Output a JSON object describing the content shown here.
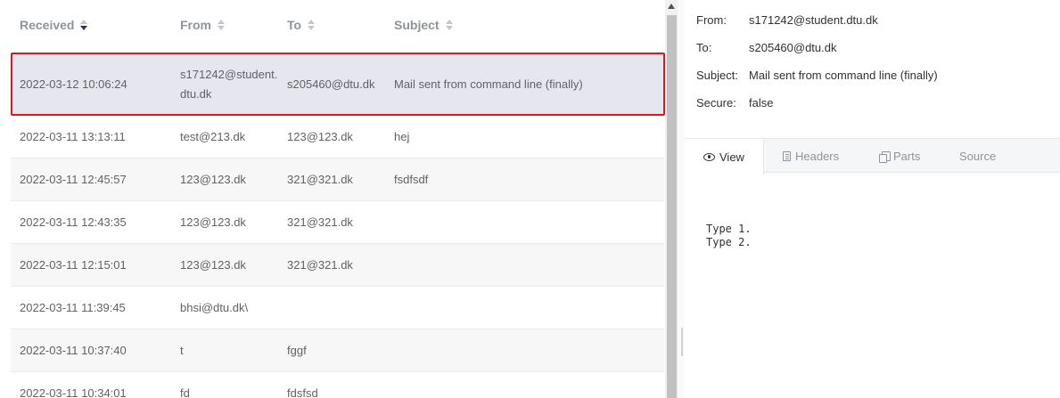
{
  "list": {
    "columns": [
      {
        "label": "Received",
        "sorted": true
      },
      {
        "label": "From",
        "sorted": false
      },
      {
        "label": "To",
        "sorted": false
      },
      {
        "label": "Subject",
        "sorted": false
      }
    ],
    "rows": [
      {
        "received": "2022-03-12 10:06:24",
        "from": "s171242@student.dtu.dk",
        "to": "s205460@dtu.dk",
        "subject": "Mail sent from command line (finally)"
      },
      {
        "received": "2022-03-11 13:13:11",
        "from": "test@213.dk",
        "to": "123@123.dk",
        "subject": "hej"
      },
      {
        "received": "2022-03-11 12:45:57",
        "from": "123@123.dk",
        "to": "321@321.dk",
        "subject": "fsdfsdf"
      },
      {
        "received": "2022-03-11 12:43:35",
        "from": "123@123.dk",
        "to": "321@321.dk",
        "subject": ""
      },
      {
        "received": "2022-03-11 12:15:01",
        "from": "123@123.dk",
        "to": "321@321.dk",
        "subject": ""
      },
      {
        "received": "2022-03-11 11:39:45",
        "from": "bhsi@dtu.dk\\",
        "to": "",
        "subject": ""
      },
      {
        "received": "2022-03-11 10:37:40",
        "from": "t",
        "to": "fggf",
        "subject": ""
      },
      {
        "received": "2022-03-11 10:34:01",
        "from": "fd",
        "to": "fdsfsd",
        "subject": ""
      }
    ]
  },
  "detail": {
    "from_label": "From:",
    "from_value": "s171242@student.dtu.dk",
    "to_label": "To:",
    "to_value": "s205460@dtu.dk",
    "subject_label": "Subject:",
    "subject_value": "Mail sent from command line (finally)",
    "secure_label": "Secure:",
    "secure_value": "false",
    "tabs": [
      {
        "label": "View",
        "icon": "eye-icon",
        "active": true
      },
      {
        "label": "Headers",
        "icon": "document-icon",
        "active": false
      },
      {
        "label": "Parts",
        "icon": "copy-icon",
        "active": false
      },
      {
        "label": "Source",
        "icon": "",
        "active": false
      }
    ],
    "body": "Type 1.\nType 2."
  },
  "colors": {
    "selection_outline": "#e3131b",
    "selected_row": "#e6e6ef",
    "sort_active": "#2b2b6e"
  }
}
